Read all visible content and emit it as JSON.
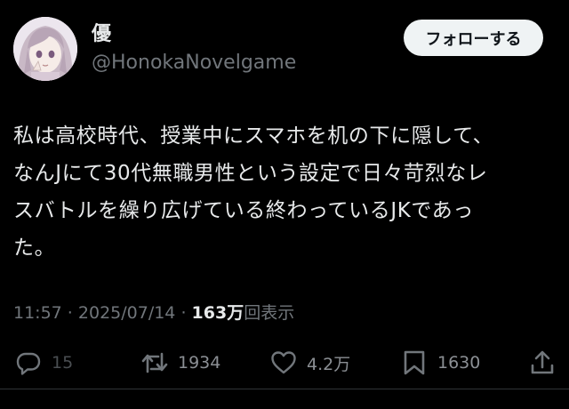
{
  "author": {
    "display_name": "優",
    "handle": "@HonokaNovelgame",
    "avatar_icon": "anime-girl-avatar"
  },
  "follow_button_label": "フォローする",
  "tweet": {
    "lines": [
      "私は高校時代、授業中にスマホを机の下に隠して、",
      "なんJにて30代無職男性という設定で日々苛烈なレ",
      "スバトルを繰り広げている終わっているJKであっ",
      "た。"
    ]
  },
  "meta": {
    "time": "11:57",
    "separator1": " · ",
    "date": "2025/07/14",
    "separator2": " · ",
    "views_count": "163万",
    "views_label": "回表示"
  },
  "actions": {
    "reply_count": "15",
    "retweet_count": "1934",
    "like_count": "4.2万",
    "bookmark_count": "1630"
  },
  "colors": {
    "background": "#000000",
    "text_primary": "#e7e9ea",
    "text_secondary": "#71767b",
    "follow_bg": "#eff3f4",
    "follow_text": "#0f1419",
    "divider": "#2f3336"
  }
}
